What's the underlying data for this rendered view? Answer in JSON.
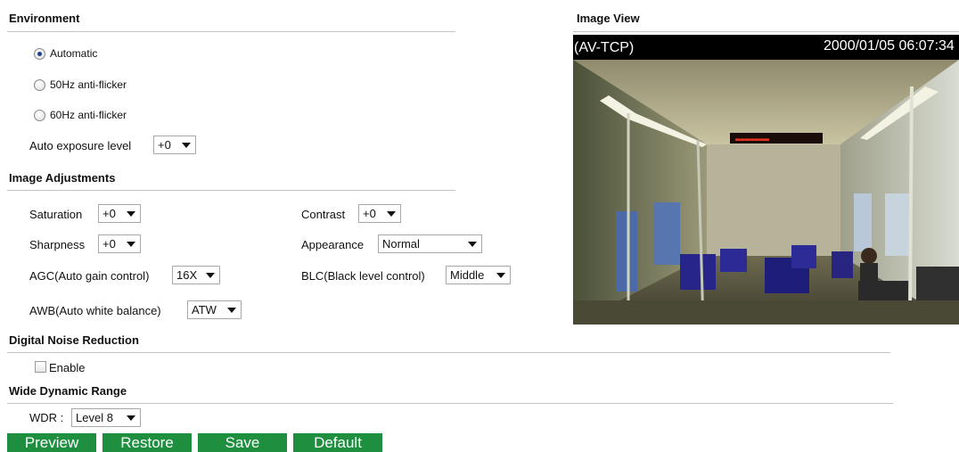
{
  "environment": {
    "title": "Environment",
    "radios": [
      {
        "label": "Automatic",
        "checked": true
      },
      {
        "label": "50Hz anti-flicker",
        "checked": false
      },
      {
        "label": "60Hz anti-flicker",
        "checked": false
      }
    ],
    "auto_exposure_label": "Auto exposure level",
    "auto_exposure_value": "+0"
  },
  "image_adjustments": {
    "title": "Image Adjustments",
    "saturation_label": "Saturation",
    "saturation_value": "+0",
    "contrast_label": "Contrast",
    "contrast_value": "+0",
    "sharpness_label": "Sharpness",
    "sharpness_value": "+0",
    "appearance_label": "Appearance",
    "appearance_value": "Normal",
    "agc_label": "AGC(Auto gain control)",
    "agc_value": "16X",
    "blc_label": "BLC(Black level control)",
    "blc_value": "Middle",
    "awb_label": "AWB(Auto white balance)",
    "awb_value": "ATW"
  },
  "dnr": {
    "title": "Digital Noise Reduction",
    "enable_label": "Enable",
    "enabled": false
  },
  "wdr": {
    "title": "Wide Dynamic Range",
    "label": "WDR :",
    "value": "Level 8"
  },
  "buttons": {
    "preview": "Preview",
    "restore": "Restore",
    "save": "Save",
    "default": "Default"
  },
  "image_view": {
    "title": "Image View",
    "overlay_left": "(AV-TCP)",
    "overlay_right": "2000/01/05 06:07:34",
    "led_sign": "▬▬▬▬▬▬▬"
  },
  "colors": {
    "button_bg": "#1e8f3f",
    "rule": "#c4c4c4"
  }
}
